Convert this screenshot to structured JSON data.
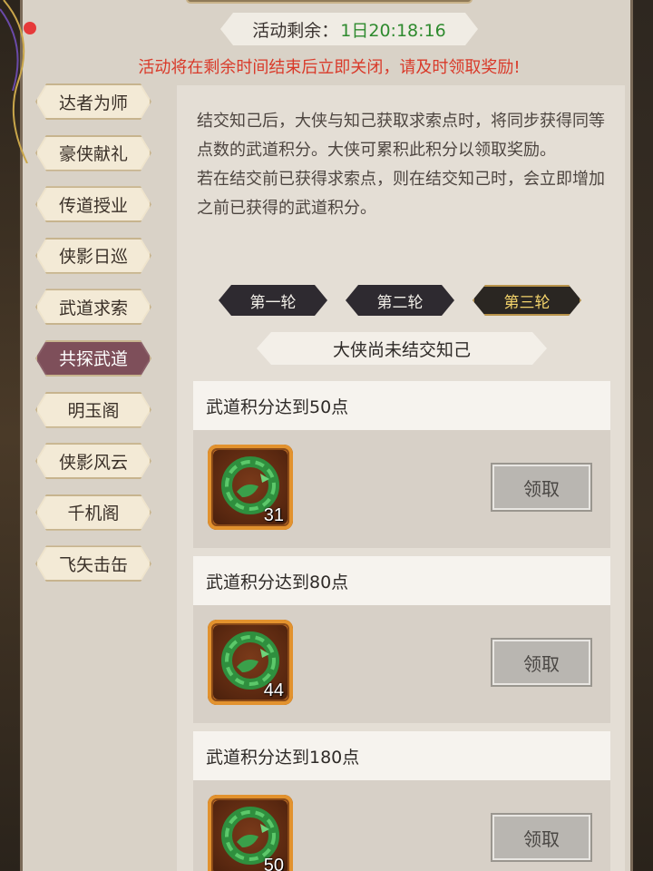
{
  "header": {
    "timer_label": "活动剩余：",
    "timer_value": "1日20:18:16",
    "notice": "活动将在剩余时间结束后立即关闭，请及时领取奖励!"
  },
  "sidebar": {
    "items": [
      {
        "label": "达者为师",
        "active": false
      },
      {
        "label": "豪侠献礼",
        "active": false
      },
      {
        "label": "传道授业",
        "active": false
      },
      {
        "label": "侠影日巡",
        "active": false
      },
      {
        "label": "武道求索",
        "active": false
      },
      {
        "label": "共探武道",
        "active": true
      },
      {
        "label": "明玉阁",
        "active": false
      },
      {
        "label": "侠影风云",
        "active": false
      },
      {
        "label": "千机阁",
        "active": false
      },
      {
        "label": "飞矢击缶",
        "active": false
      }
    ]
  },
  "main": {
    "description": [
      "结交知己后，大侠与知己获取求索点时，将同步获得同等点数的武道积分。大侠可累积此积分以领取奖励。",
      "若在结交前已获得求索点，则在结交知己时，会立即增加之前已获得的武道积分。"
    ],
    "round_tabs": [
      {
        "label": "第一轮",
        "active": false
      },
      {
        "label": "第二轮",
        "active": false
      },
      {
        "label": "第三轮",
        "active": true
      }
    ],
    "status": "大侠尚未结交知己",
    "rewards": [
      {
        "title": "武道积分达到50点",
        "item_icon": "jade-ring-icon",
        "count": "31",
        "button": "领取"
      },
      {
        "title": "武道积分达到80点",
        "item_icon": "jade-ring-icon",
        "count": "44",
        "button": "领取"
      },
      {
        "title": "武道积分达到180点",
        "item_icon": "jade-ring-icon",
        "count": "50",
        "button": "领取"
      }
    ]
  },
  "colors": {
    "panel_bg": "#d9d2c7",
    "notice_red": "#d93a2a",
    "timer_green": "#2e8a2e",
    "active_tab_purple": "#8a5f68",
    "item_frame_orange": "#c8742a",
    "jade_green": "#3aa04a"
  }
}
